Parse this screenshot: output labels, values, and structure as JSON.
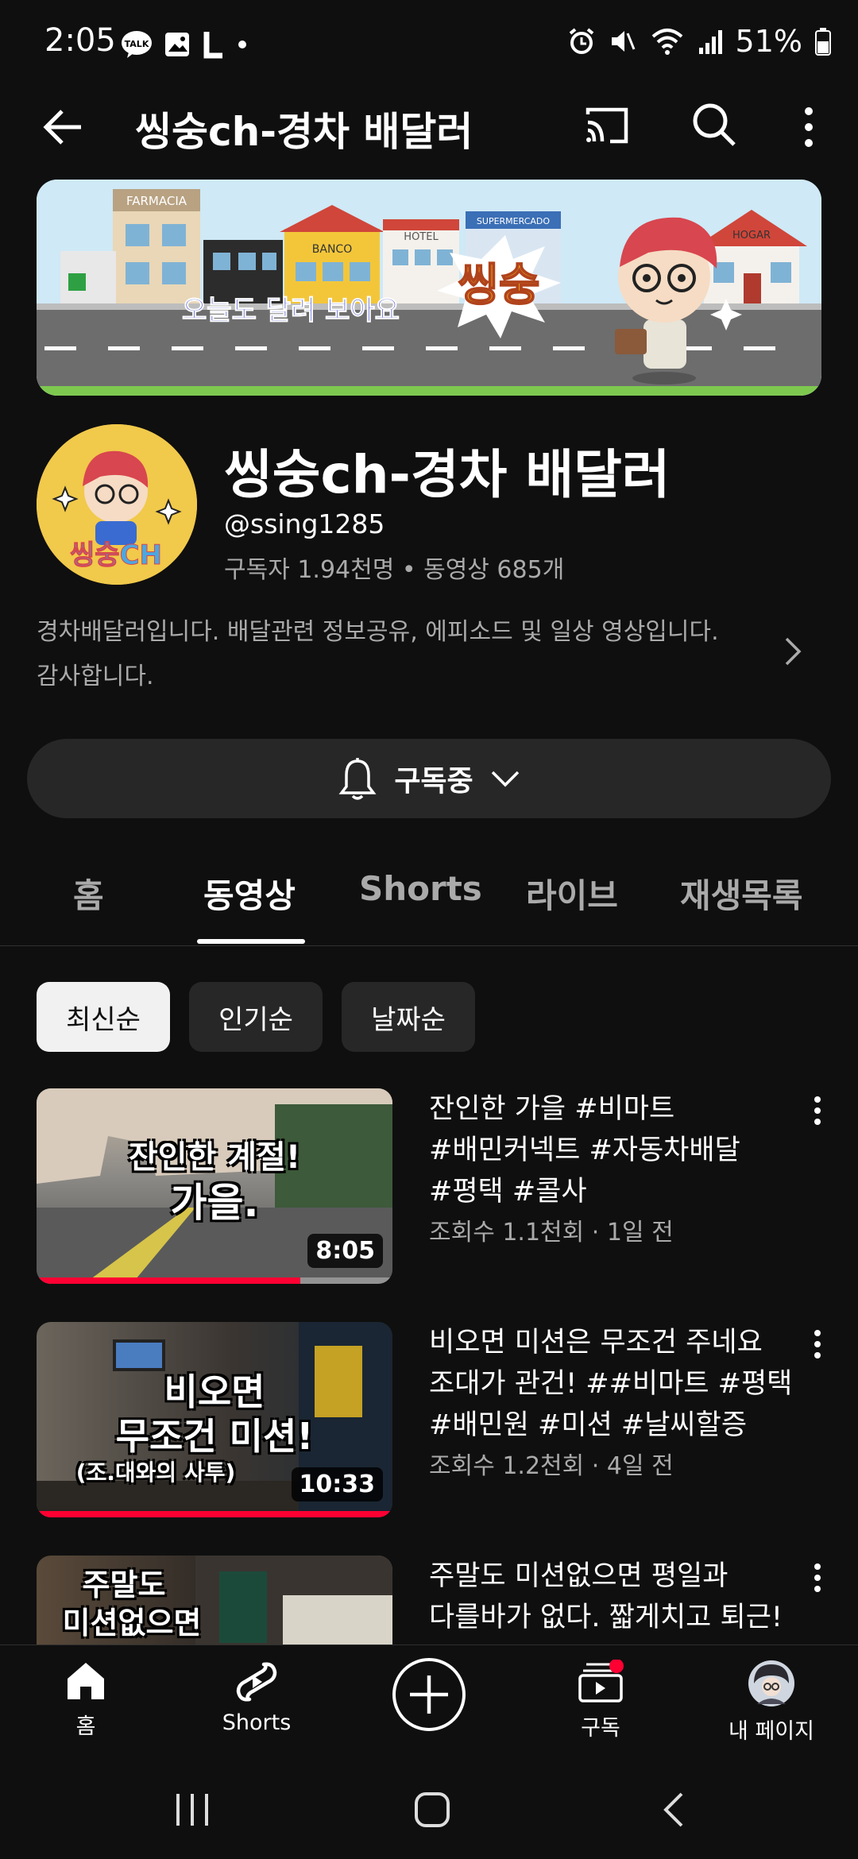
{
  "status_bar": {
    "time": "2:05",
    "battery": "51%"
  },
  "app_bar": {
    "title": "씽숭ch-경차 배달러",
    "icons": [
      "back-arrow-icon",
      "cast-icon",
      "search-icon",
      "more-vert-icon"
    ]
  },
  "banner": {
    "slogan": "오늘도 달려 보아요",
    "logo_text": "씽숭",
    "signs": [
      "FARMACIA",
      "BANCO",
      "HOTEL",
      "SUPERMERCADO",
      "HOGAR"
    ]
  },
  "channel": {
    "name": "씽숭ch-경차 배달러",
    "handle": "@ssing1285",
    "stats": "구독자 1.94천명 • 동영상 685개",
    "description_line1": "경차배달러입니다. 배달관련 정보공유, 에피소드 및 일상 영상입니다.",
    "description_line2": "감사합니다.",
    "avatar_text": "씽숭CH"
  },
  "subscribe": {
    "label": "구독중"
  },
  "tabs": [
    {
      "label": "홈",
      "active": false
    },
    {
      "label": "동영상",
      "active": true
    },
    {
      "label": "Shorts",
      "active": false
    },
    {
      "label": "라이브",
      "active": false
    },
    {
      "label": "재생목록",
      "active": false
    }
  ],
  "chips": [
    {
      "label": "최신순",
      "active": true
    },
    {
      "label": "인기순",
      "active": false
    },
    {
      "label": "날짜순",
      "active": false
    }
  ],
  "videos": [
    {
      "title_lines": [
        "잔인한 가을 #비마트",
        "#배민커넥트 #자동차배달",
        "#평택 #콜사"
      ],
      "meta": "조회수 1.1천회 · 1일 전",
      "duration": "8:05",
      "thumb_text_1": "잔인한 계절!",
      "thumb_text_2": "가을.",
      "progress": 0.74
    },
    {
      "title_lines": [
        "비오면 미션은 무조건 주네요",
        "조대가 관건! ##비마트 #평택",
        "#배민원 #미션 #날씨할증"
      ],
      "meta": "조회수 1.2천회 · 4일 전",
      "duration": "10:33",
      "thumb_text_1": "비오면",
      "thumb_text_2": "무조건 미션!",
      "thumb_text_3": "(조.대와의 사투)",
      "progress": 1.0
    },
    {
      "title_lines": [
        "주말도 미션없으면 평일과",
        "다를바가 없다. 짧게치고 퇴근!"
      ],
      "thumb_text_1": "주말도",
      "thumb_text_2": "미션없으면"
    }
  ],
  "bottom_nav": [
    {
      "label": "홈",
      "icon": "home-icon"
    },
    {
      "label": "Shorts",
      "icon": "shorts-icon"
    },
    {
      "label": "",
      "icon": "create-plus-icon"
    },
    {
      "label": "구독",
      "icon": "subscriptions-icon"
    },
    {
      "label": "내 페이지",
      "icon": "profile-avatar-icon"
    }
  ],
  "colors": {
    "background": "#0f0f0f",
    "surface": "#272727",
    "accent_red": "#ff0033",
    "text_secondary": "#aaaaaa"
  }
}
